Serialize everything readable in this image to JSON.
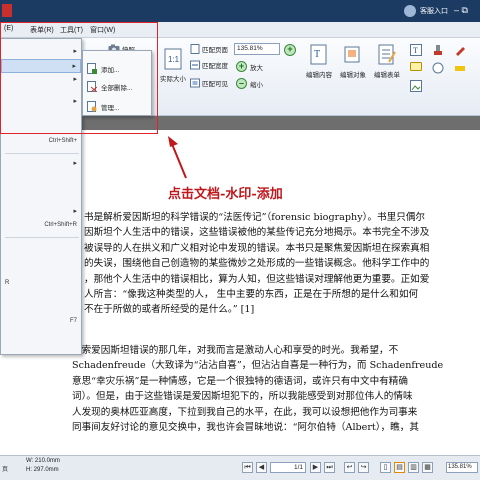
{
  "titlebar": {
    "user_name": "客服入口",
    "controls": "–  ⧉"
  },
  "menubar": {
    "items": [
      {
        "label": "(E)",
        "id": "edit"
      },
      {
        "label": "表单(R)",
        "id": "form"
      },
      {
        "label": "工具(T)",
        "id": "tools"
      },
      {
        "label": "窗口(W)",
        "id": "window"
      }
    ]
  },
  "ribbon": {
    "snapshot": "快照",
    "actual_size": "实际大小",
    "fit_page": "匹配页面",
    "fit_width": "匹配宽度",
    "fit_visible": "匹配可见",
    "zoom_value": "135.81%",
    "zoom_in": "放大",
    "zoom_out": "缩小",
    "edit_content": "编辑内容",
    "edit_object": "编辑对象",
    "edit_form": "编辑表单"
  },
  "dropdown": {
    "shortcut_1": "Ctrl+Shift+",
    "shortcut_2": "Ctrl+Shift+R",
    "item_r": "R",
    "item_f7": "F7"
  },
  "submenu": {
    "add": "添加...",
    "remove_all": "全部删除...",
    "manage": "管理..."
  },
  "annotation": {
    "text": "点击文档-水印-添加"
  },
  "document": {
    "para1": [
      "书是解析爱因斯坦的科学错误的“法医传记”（forensic biography）。书里只偶尔",
      "因斯坦个人生活中的错误，这些错误被他的某些传记充分地揭示。本书完全不涉及",
      "被误导的人在拱义和广义相对论中发现的错误。本书只是聚焦爱因斯坦在探索真相",
      "的失误，围绕他自己创造物的某些微妙之处形成的一些错误概念。他科学工作中的",
      "，那他个人生活中的错误相比，算为人知，但这些错误对理解他更为重要。正如爱",
      "人所言：“像我这种类型的人，    生中主要的东西，正是在于所想的是什么和如何",
      "不在于所做的或者所经受的是什么。” [1]"
    ],
    "para2": [
      "探索爱因斯坦错误的那几年，对我而言是激动人心和享受的时光。我希望，不",
      "Schadenfreude（大致译为“沾沾自喜”，但沾沾自喜是一种行为，而 Schadenfreude",
      "意思“幸灾乐祸”是一种情感，它是一个很独特的德语词，或许只有中文中有精确",
      "词）。但是，由于这些错误是爱因斯坦犯下的，所以我能感受到对那位伟人的情味",
      "人发现的奥林匹亚高度，下拉到我自己的水平，在此，我可以设想把他作为司事来",
      "同事间友好讨论的意见交换中，我也许会冒昧地说：“阿尔伯特（Albert），瞧，其"
    ]
  },
  "statusbar": {
    "left_label": "页",
    "page_w": "W: 210.0mm",
    "page_h": "H: 297.0mm",
    "page_current": "1",
    "page_total": "/1",
    "zoom": "135.81%"
  },
  "colors": {
    "titlebar": "#1b3b63",
    "annotation_red": "#c0171c",
    "highlight_box": "#e0242b"
  }
}
